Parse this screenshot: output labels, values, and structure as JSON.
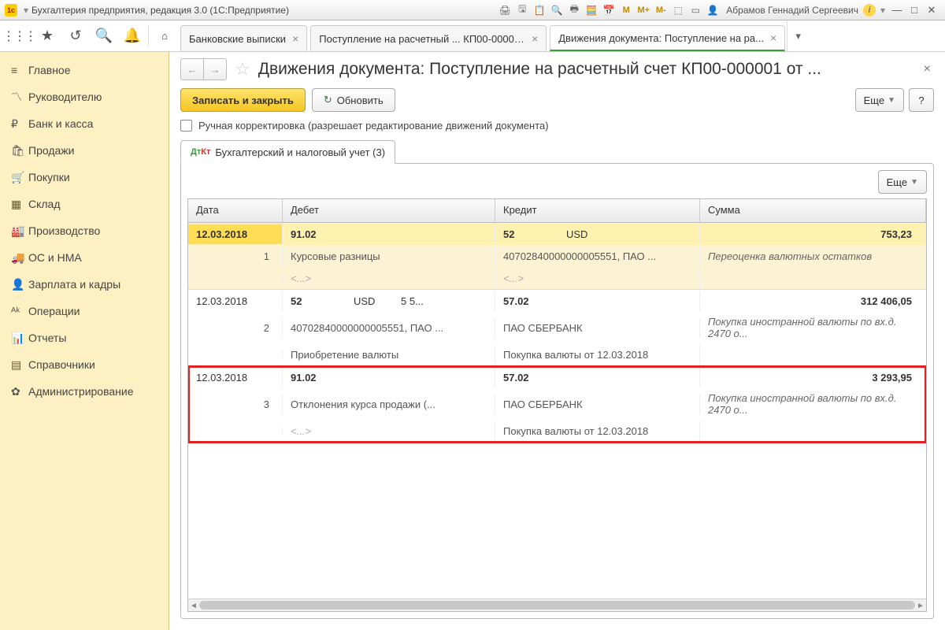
{
  "titlebar": {
    "app_title": "Бухгалтерия предприятия, редакция 3.0  (1С:Предприятие)",
    "user": "Абрамов Геннадий Сергеевич",
    "m1": "M",
    "m2": "M+",
    "m3": "M-"
  },
  "tabs": {
    "t1": "Банковские выписки",
    "t2": "Поступление на расчетный ... КП00-000001",
    "t3": "Движения документа: Поступление на ра..."
  },
  "sidebar": [
    {
      "icon": "≡",
      "label": "Главное"
    },
    {
      "icon": "〽",
      "label": "Руководителю"
    },
    {
      "icon": "₽",
      "label": "Банк и касса"
    },
    {
      "icon": "🛍",
      "label": "Продажи"
    },
    {
      "icon": "🛒",
      "label": "Покупки"
    },
    {
      "icon": "▦",
      "label": "Склад"
    },
    {
      "icon": "🏭",
      "label": "Производство"
    },
    {
      "icon": "🚚",
      "label": "ОС и НМА"
    },
    {
      "icon": "👤",
      "label": "Зарплата и кадры"
    },
    {
      "icon": "ᴬᵏ",
      "label": "Операции"
    },
    {
      "icon": "📊",
      "label": "Отчеты"
    },
    {
      "icon": "▤",
      "label": "Справочники"
    },
    {
      "icon": "✿",
      "label": "Администрирование"
    }
  ],
  "page": {
    "title": "Движения документа: Поступление на расчетный счет КП00-000001 от ...",
    "save": "Записать и закрыть",
    "refresh": "Обновить",
    "more": "Еще",
    "help": "?",
    "manual_label": "Ручная корректировка (разрешает редактирование движений документа)",
    "tab_label": "Бухгалтерский и налоговый учет (3)"
  },
  "table": {
    "h_date": "Дата",
    "h_debit": "Дебет",
    "h_credit": "Кредит",
    "h_sum": "Сумма",
    "rows": [
      {
        "date": "12.03.2018",
        "num": "1",
        "d_acct": "91.02",
        "d_cur": "",
        "d_qty": "",
        "c_acct": "52",
        "c_cur": "USD",
        "c_qty": "",
        "sum": "753,23",
        "d2": "Курсовые разницы",
        "c2": "40702840000000005551, ПАО ...",
        "s2": "Переоценка валютных остатков",
        "d3": "<...>",
        "c3": "<...>"
      },
      {
        "date": "12.03.2018",
        "num": "2",
        "d_acct": "52",
        "d_cur": "USD",
        "d_qty": "5 5...",
        "c_acct": "57.02",
        "c_cur": "",
        "c_qty": "",
        "sum": "312 406,05",
        "d2": "40702840000000005551, ПАО ...",
        "c2": "ПАО СБЕРБАНК",
        "s2": "Покупка иностранной валюты по вх.д. 2470 о...",
        "d3": "Приобретение валюты",
        "c3": "Покупка валюты от 12.03.2018"
      },
      {
        "date": "12.03.2018",
        "num": "3",
        "d_acct": "91.02",
        "d_cur": "",
        "d_qty": "",
        "c_acct": "57.02",
        "c_cur": "",
        "c_qty": "",
        "sum": "3 293,95",
        "d2": "Отклонения курса продажи (...",
        "c2": "ПАО СБЕРБАНК",
        "s2": "Покупка иностранной валюты по вх.д. 2470 о...",
        "d3": "<...>",
        "c3": "Покупка валюты от 12.03.2018"
      }
    ]
  }
}
